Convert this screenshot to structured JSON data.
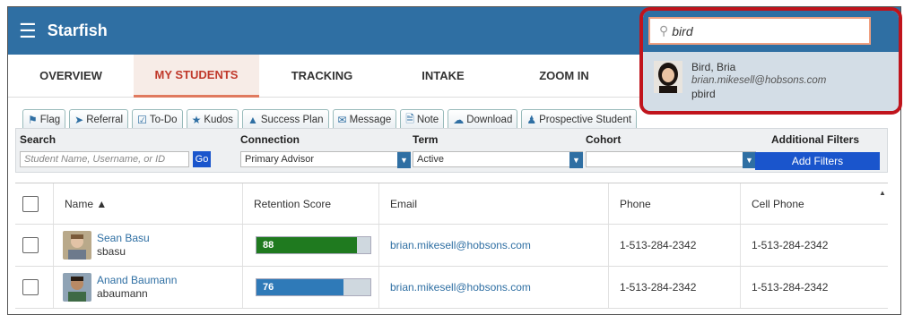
{
  "app": {
    "title": "Starfish"
  },
  "tabs": [
    "OVERVIEW",
    "MY STUDENTS",
    "TRACKING",
    "INTAKE",
    "ZOOM IN"
  ],
  "toolbar": {
    "flag": "Flag",
    "referral": "Referral",
    "todo": "To-Do",
    "kudos": "Kudos",
    "success_plan": "Success Plan",
    "message": "Message",
    "note": "Note",
    "download": "Download",
    "prospective": "Prospective Student"
  },
  "filters": {
    "search_label": "Search",
    "search_placeholder": "Student Name, Username, or ID",
    "go": "Go",
    "connection_label": "Connection",
    "connection_value": "Primary Advisor",
    "term_label": "Term",
    "term_value": "Active",
    "cohort_label": "Cohort",
    "cohort_value": "",
    "additional_label": "Additional Filters",
    "add_filters": "Add Filters"
  },
  "table": {
    "headers": {
      "name": "Name ▲",
      "retention": "Retention Score",
      "email": "Email",
      "phone": "Phone",
      "cell": "Cell Phone"
    },
    "rows": [
      {
        "name": "Sean Basu",
        "username": "sbasu",
        "score": 88,
        "score_color": "#1f7a1f",
        "email": "brian.mikesell@hobsons.com",
        "phone": "1-513-284-2342",
        "cell": "1-513-284-2342"
      },
      {
        "name": "Anand Baumann",
        "username": "abaumann",
        "score": 76,
        "score_color": "#2f7ab8",
        "email": "brian.mikesell@hobsons.com",
        "phone": "1-513-284-2342",
        "cell": "1-513-284-2342"
      }
    ]
  },
  "search_popup": {
    "query": "bird",
    "result": {
      "name": "Bird, Bria",
      "email": "brian.mikesell@hobsons.com",
      "username": "pbird"
    }
  },
  "colors": {
    "brand": "#2f6fa3",
    "highlight": "#c0141c",
    "active_tab": "#c0392b"
  }
}
